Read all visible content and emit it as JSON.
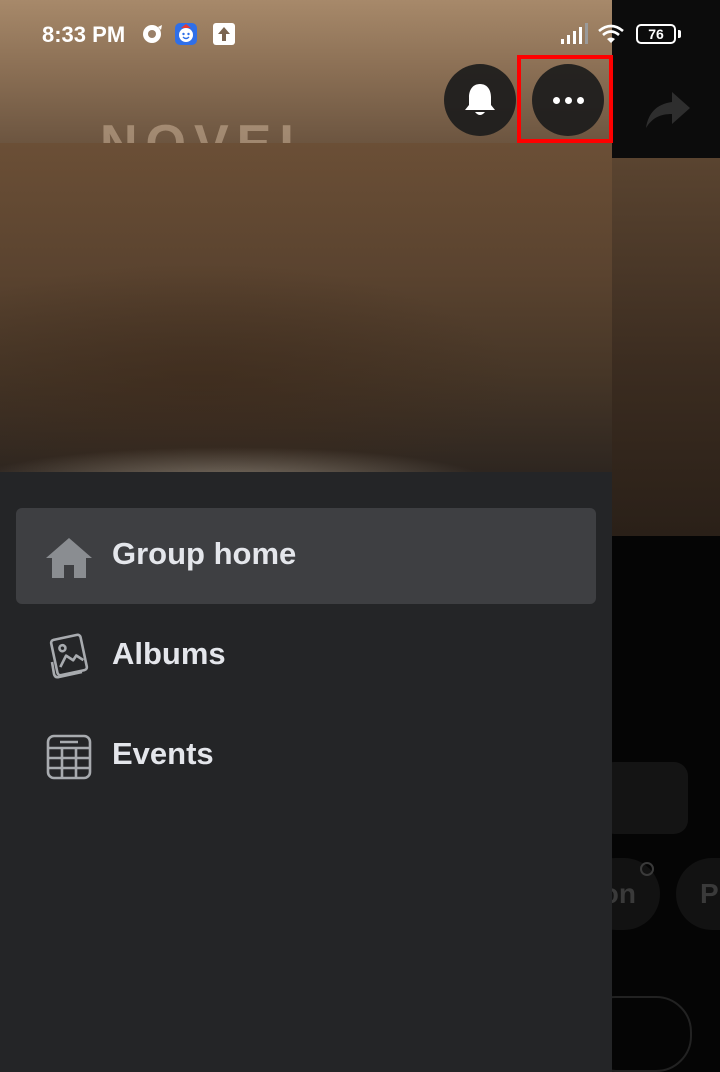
{
  "status_bar": {
    "time": "8:33 PM",
    "battery": "76",
    "icons": [
      "sync-icon",
      "messenger-kids-icon",
      "upload-icon",
      "signal-icon",
      "wifi-icon"
    ]
  },
  "header": {
    "notifications_icon": "bell-icon",
    "more_icon": "more-horizontal-icon",
    "share_icon": "share-arrow-icon"
  },
  "menu": {
    "items": [
      {
        "label": "Group home",
        "icon": "home-icon",
        "active": true
      },
      {
        "label": "Albums",
        "icon": "albums-icon",
        "active": false
      },
      {
        "label": "Events",
        "icon": "calendar-icon",
        "active": false
      }
    ]
  },
  "background": {
    "chip1_text": "on",
    "chip2_text": "P"
  },
  "colors": {
    "drawer_bg": "#242527",
    "active_item_bg": "#3e3f42",
    "label_text": "#e4e6eb",
    "highlight": "#ff0000"
  }
}
